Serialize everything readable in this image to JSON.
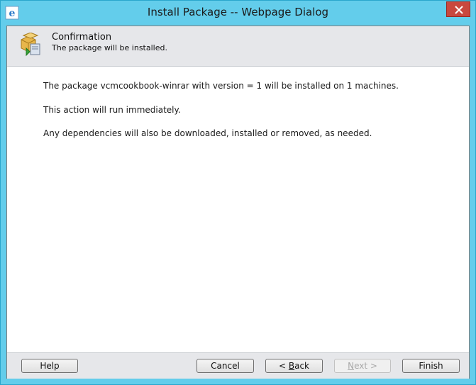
{
  "window": {
    "title": "Install Package -- Webpage Dialog",
    "close_icon": "close-icon",
    "app_icon": "ie-icon"
  },
  "header": {
    "title": "Confirmation",
    "subtitle": "The package will be installed.",
    "icon": "package-icon"
  },
  "body": {
    "lines": [
      "The package vcmcookbook-winrar with version = 1 will be installed on 1 machines.",
      "This action will run immediately.",
      "Any dependencies will also be downloaded, installed or removed, as needed."
    ]
  },
  "footer": {
    "help_label": "Help",
    "cancel_label": "Cancel",
    "back_prefix": "< ",
    "back_accel": "B",
    "back_rest": "ack",
    "next_prefix": "N",
    "next_rest": "ext >",
    "finish_label": "Finish"
  },
  "colors": {
    "titlebar": "#63cdeb",
    "close": "#c9483e",
    "panel": "#e6e7ea"
  }
}
